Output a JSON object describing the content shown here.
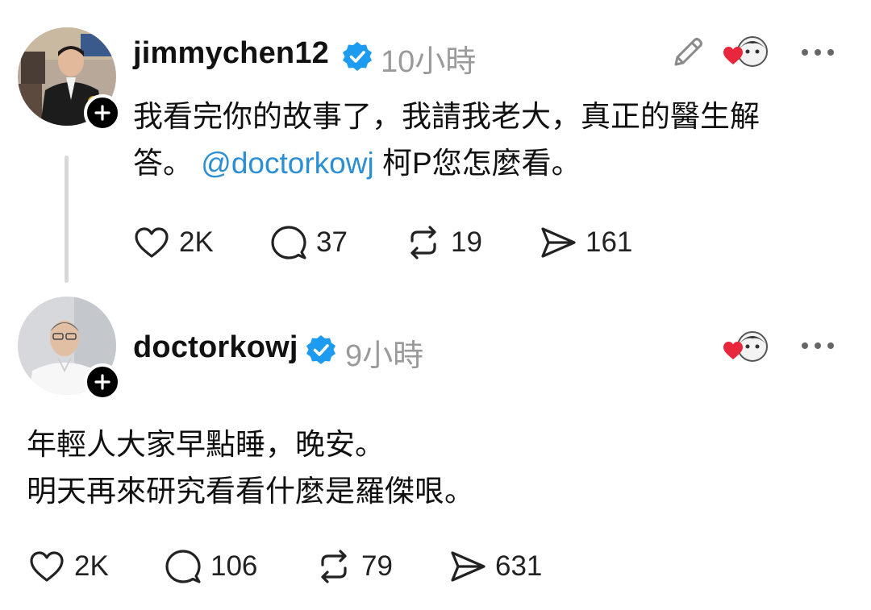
{
  "posts": [
    {
      "username": "jimmychen12",
      "timestamp": "10小時",
      "text_line1": "我看完你的故事了，我請我老大，真正的醫生解",
      "text_line2_pre": "答。 ",
      "text_line2_mention": "@doctorkowj",
      "text_line2_post": " 柯P您怎麼看。",
      "likes": "2K",
      "comments": "37",
      "reposts": "19",
      "shares": "161"
    },
    {
      "username": "doctorkowj",
      "timestamp": "9小時",
      "text_line1": "年輕人大家早點睡，晚安。",
      "text_line2": "明天再來研究看看什麼是羅傑哏。",
      "likes": "2K",
      "comments": "106",
      "reposts": "79",
      "shares": "631"
    }
  ],
  "icons": {
    "verified": "verified-badge-icon",
    "edit": "pencil-icon",
    "like": "heart-icon",
    "comment": "comment-bubble-icon",
    "repost": "repost-icon",
    "share": "send-icon",
    "more": "more-dots-icon",
    "follow": "plus-icon"
  },
  "colors": {
    "verified": "#1d9bf0",
    "mention": "#2b8fd6",
    "timestamp": "#9a9a9a",
    "heart": "#e8273c"
  }
}
